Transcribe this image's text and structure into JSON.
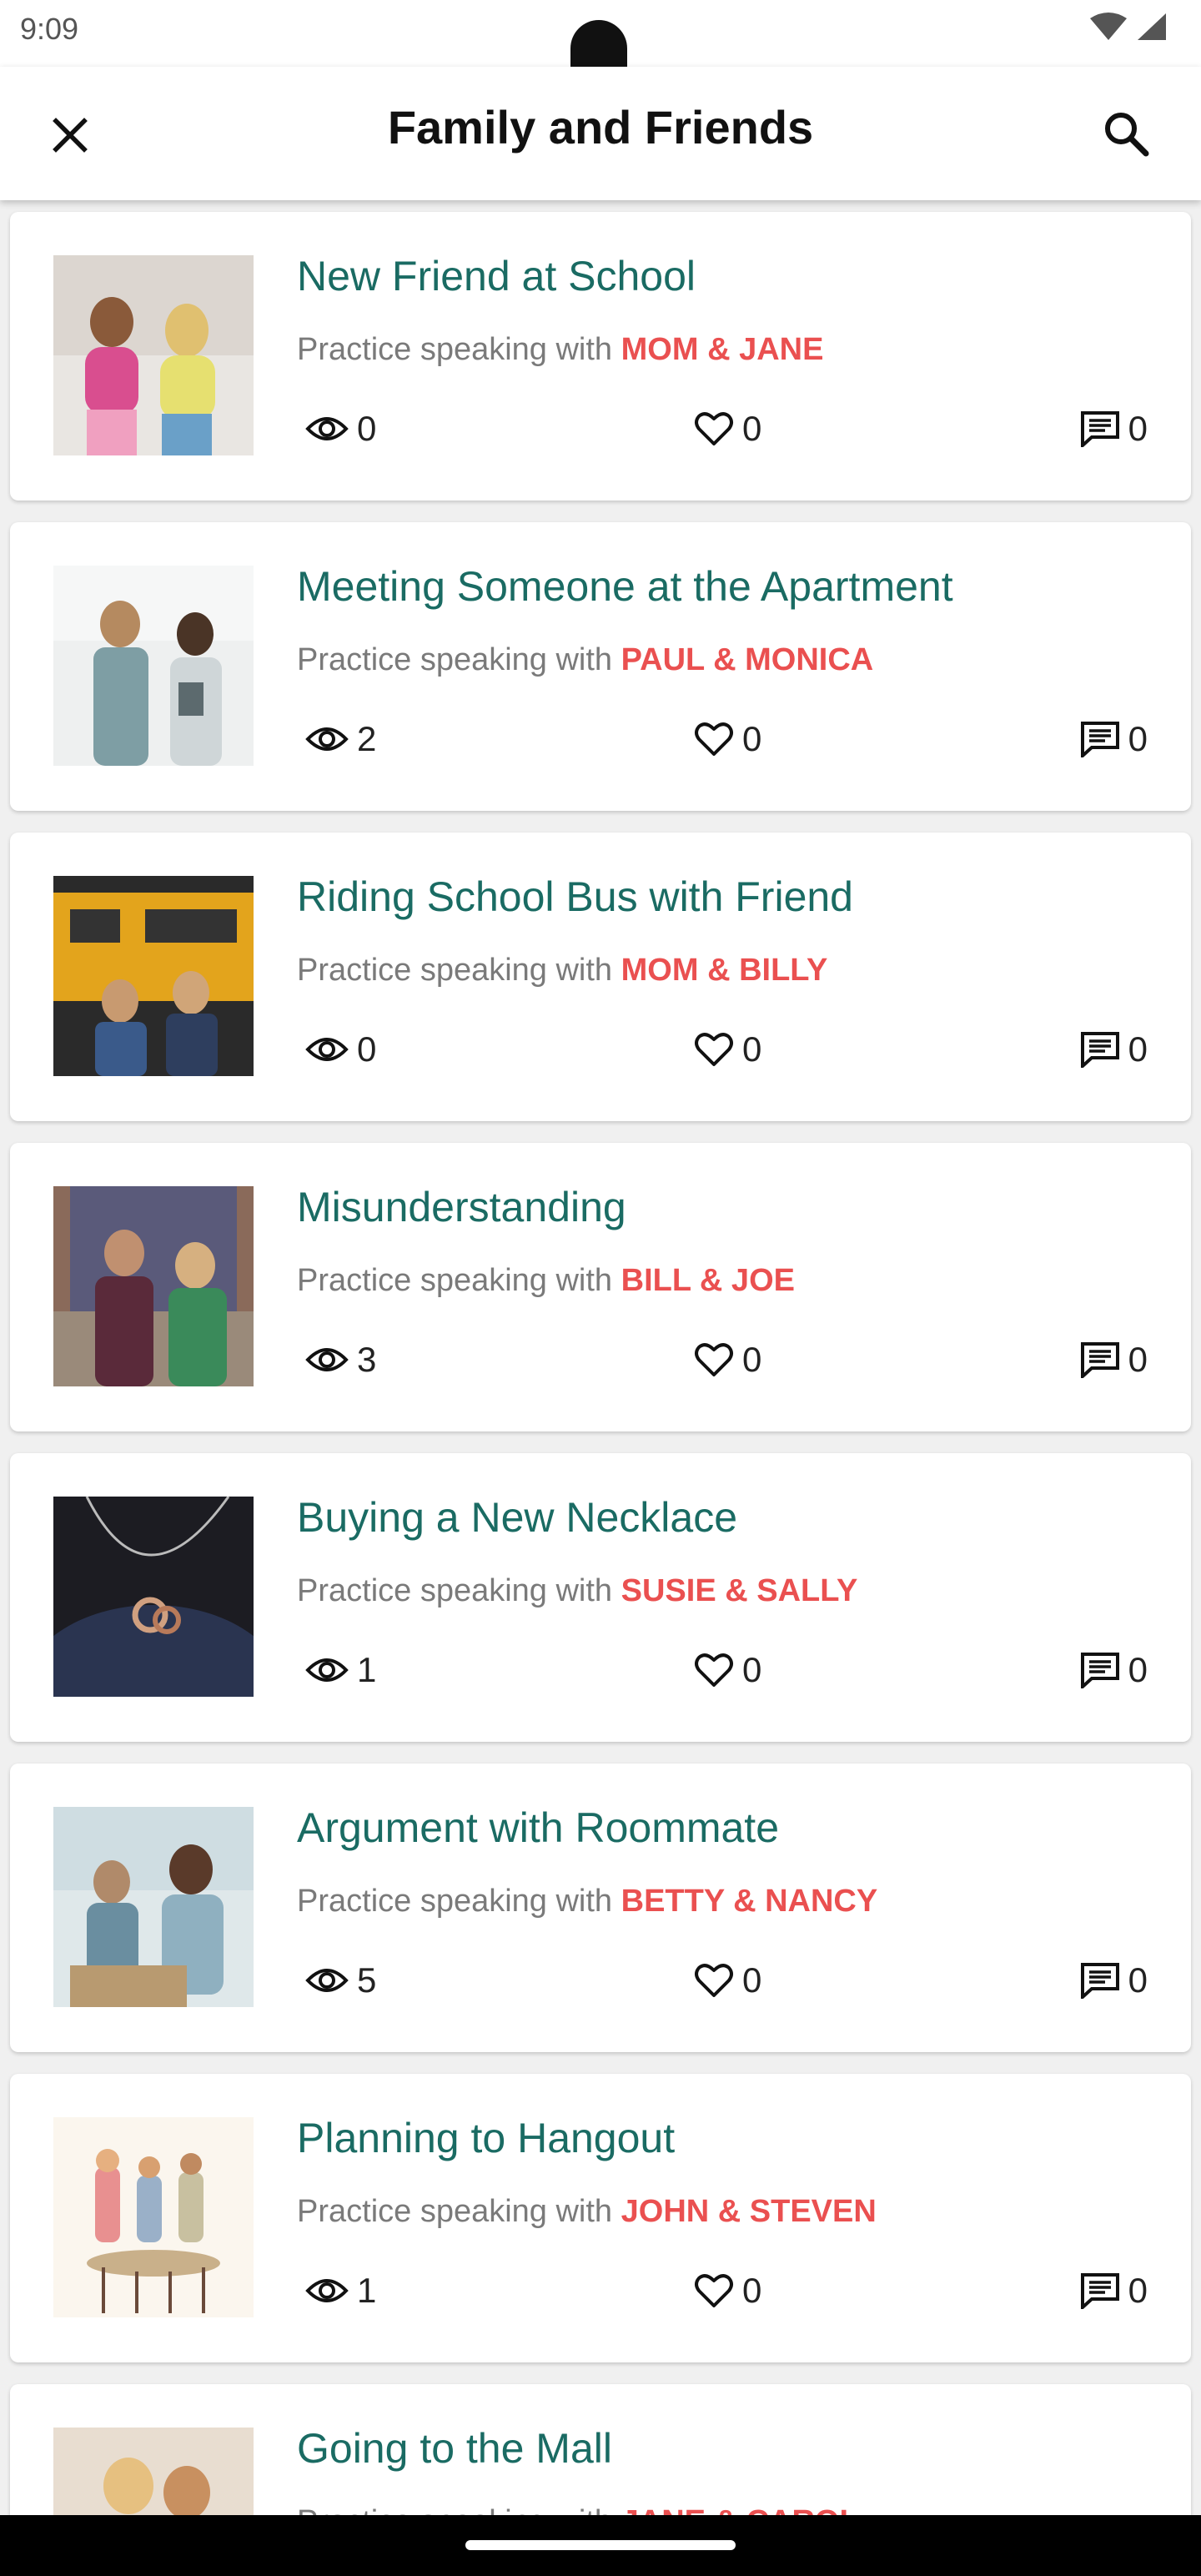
{
  "status_bar": {
    "time": "9:09",
    "icons": [
      "wifi-icon",
      "signal-icon"
    ]
  },
  "app_bar": {
    "title": "Family and Friends",
    "left_icon": "close-icon",
    "right_icon": "search-icon"
  },
  "colors": {
    "title_teal": "#1a6b63",
    "names_red": "#ea5050",
    "subtitle_gray": "#7a7a7a"
  },
  "subtitle_prefix": "Practice speaking with",
  "cards": [
    {
      "title": "New Friend at School",
      "partners": "MOM & JANE",
      "views": "0",
      "likes": "0",
      "comments": "0"
    },
    {
      "title": "Meeting Someone at the Apartment",
      "partners": "PAUL & MONICA",
      "views": "2",
      "likes": "0",
      "comments": "0"
    },
    {
      "title": "Riding School Bus with Friend",
      "partners": "MOM & BILLY",
      "views": "0",
      "likes": "0",
      "comments": "0"
    },
    {
      "title": "Misunderstanding",
      "partners": "BILL & JOE",
      "views": "3",
      "likes": "0",
      "comments": "0"
    },
    {
      "title": "Buying a New Necklace",
      "partners": "SUSIE & SALLY",
      "views": "1",
      "likes": "0",
      "comments": "0"
    },
    {
      "title": "Argument with Roommate",
      "partners": "BETTY & NANCY",
      "views": "5",
      "likes": "0",
      "comments": "0"
    },
    {
      "title": "Planning to Hangout",
      "partners": "JOHN & STEVEN",
      "views": "1",
      "likes": "0",
      "comments": "0"
    },
    {
      "title": "Going to the Mall",
      "partners": "JANE & CAROL",
      "views": "",
      "likes": "",
      "comments": ""
    }
  ]
}
